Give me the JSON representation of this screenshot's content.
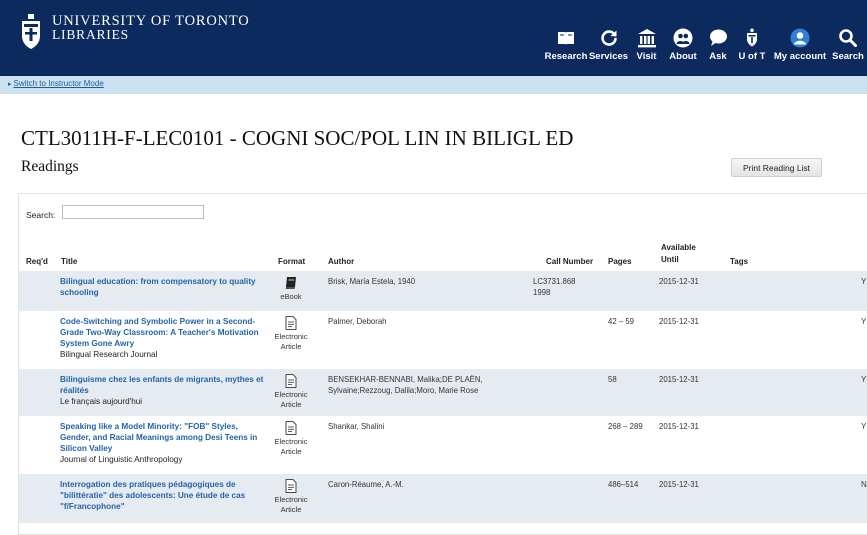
{
  "header": {
    "logo": {
      "line1": "UNIVERSITY OF TORONTO",
      "line2": "LIBRARIES"
    },
    "nav": [
      {
        "label": "Research",
        "icon": "book-icon"
      },
      {
        "label": "Services",
        "icon": "refresh-icon"
      },
      {
        "label": "Visit",
        "icon": "building-icon"
      },
      {
        "label": "About",
        "icon": "people-icon"
      },
      {
        "label": "Ask",
        "icon": "chat-bubble-icon"
      },
      {
        "label": "U of T",
        "icon": "crest-icon"
      },
      {
        "label": "My account",
        "icon": "user-icon"
      },
      {
        "label": "Search",
        "icon": "search-icon"
      }
    ],
    "colors": {
      "background": "#0c2a5e",
      "text": "#ffffff"
    }
  },
  "instructor_link": "Switch to Instructor Mode",
  "course_title": "CTL3011H-F-LEC0101 - COGNI SOC/POL LIN IN BILIGL ED",
  "readings_title": "Readings",
  "print_button": "Print Reading List",
  "search": {
    "label": "Search:",
    "value": ""
  },
  "table": {
    "headers": {
      "reqd": "Req'd",
      "title": "Title",
      "format": "Format",
      "author": "Author",
      "call_number": "Call Number",
      "pages": "Pages",
      "available_line1": "Available",
      "available_line2": "Until",
      "tags": "Tags"
    },
    "rows": [
      {
        "title": "Bilingual education: from compensatory to quality schooling",
        "source": "",
        "format": "eBook",
        "format_icon": "ebook-icon",
        "author": "Brisk, María Estela, 1940",
        "call_number": "LC3731.868 1998",
        "pages": "",
        "available_until": "2015-12-31",
        "edge": "Y"
      },
      {
        "title": "Code-Switching and Symbolic Power in a Second-Grade Two-Way Classroom: A Teacher's Motivation System Gone Awry",
        "source": "Bilingual Research Journal",
        "format": "Electronic Article",
        "format_icon": "document-icon",
        "author": "Palmer, Deborah",
        "call_number": "",
        "pages": "42 – 59",
        "available_until": "2015-12-31",
        "edge": "Y"
      },
      {
        "title": "Bilinguisme chez les enfants de migrants, mythes et réalités",
        "source": "Le français aujourd'hui",
        "format": "Electronic Article",
        "format_icon": "document-icon",
        "author": "BENSEKHAR-BENNABI, Malika;DE PLAËN, Sylvaine;Rezzoug, Dalila;Moro, Marie Rose",
        "call_number": "",
        "pages": "58",
        "available_until": "2015-12-31",
        "edge": "Y"
      },
      {
        "title": "Speaking like a Model Minority: \"FOB\" Styles, Gender, and Racial Meanings among Desi Teens in Silicon Valley",
        "source": "Journal of Linguistic Anthropology",
        "format": "Electronic Article",
        "format_icon": "document-icon",
        "author": "Shankar, Shalini",
        "call_number": "",
        "pages": "268 – 289",
        "available_until": "2015-12-31",
        "edge": "Y"
      },
      {
        "title": "Interrogation des pratiques pédagogiques de \"bilittératie\" des adolescents: Une étude de cas \"f/Francophone\"",
        "source": "",
        "format": "Electronic Article",
        "format_icon": "document-icon",
        "author": "Caron-Réaume, A.-M.",
        "call_number": "",
        "pages": "486–514",
        "available_until": "2015-12-31",
        "edge": "N"
      }
    ]
  }
}
